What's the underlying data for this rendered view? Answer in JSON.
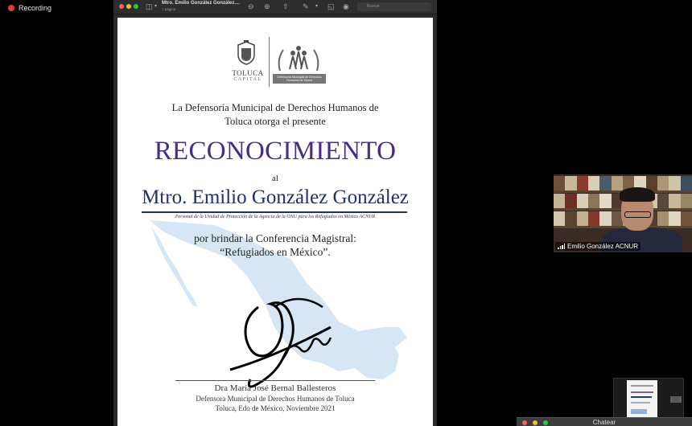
{
  "recording": {
    "label": "Recording",
    "color": "#e53935"
  },
  "viewer": {
    "title": "Mtro. Emilio González González....",
    "subtitle": "1 página",
    "search_placeholder": "Buscar",
    "icons": [
      "sidebar-icon",
      "zoom-out-icon",
      "zoom-in-icon",
      "share-icon",
      "markup-icon",
      "rotate-icon",
      "annotate-icon",
      "search-icon"
    ]
  },
  "certificate": {
    "logo_left_text": "TOLUCA",
    "logo_left_sub": "CAPITAL",
    "logo_right_band": "Defensoría Municipal de Derechos Humanos de Toluca",
    "intro_line1": "La Defensoría Municipal de Derechos Humanos de",
    "intro_line2": "Toluca otorga el presente",
    "title": "RECONOCIMIENTO",
    "connector": "al",
    "recipient": "Mtro. Emilio González González",
    "position": "Personal de la Unidad de Protección de la Agencia de la ONU para los Refugiados en México ACNUR",
    "reason_line1": "por brindar la Conferencia Magistral:",
    "reason_line2": "“Refugiados en México”.",
    "signer_name": "Dra María José Bernal Ballesteros",
    "signer_title": "Defensora Municipal de Derechos Humanos de Toluca",
    "place_date": "Toluca, Edo de México, Noviembre 2021",
    "title_color": "#4b2b8a",
    "name_color": "#1f2f70"
  },
  "participant": {
    "name": "Emilio González ACNUR"
  },
  "chat": {
    "label": "Chatear"
  }
}
